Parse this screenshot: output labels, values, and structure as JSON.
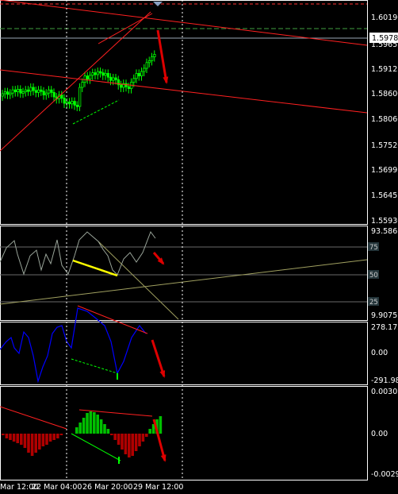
{
  "colors": {
    "background": "#000000",
    "panel_border": "#ffffff",
    "candle_up": "#00ff00",
    "candle_down": "#00ff00",
    "trendline": "#ff2020",
    "stochastic_line": "#9aa59a",
    "macd_line": "#0000ff",
    "hist_up": "#00c000",
    "hist_down": "#b00000",
    "divergence_bull": "#ffff00",
    "arrow": "#dd0000"
  },
  "price_panel": {
    "current_price": "1.59783",
    "axis_labels": [
      "1.60190",
      "1.59653",
      "1.59125",
      "1.58600",
      "1.58060",
      "1.57520",
      "1.56995",
      "1.56455",
      "1.55930"
    ]
  },
  "stochastic_panel": {
    "max_label": "93.586",
    "min_label": "9.9075",
    "levels": [
      "75",
      "50",
      "25"
    ]
  },
  "macd_panel": {
    "max_label": "278.1721",
    "zero_label": "0.00",
    "min_label": "-291.981"
  },
  "oscillator_panel": {
    "max_label": "0.003024",
    "zero_label": "0.00",
    "min_label": "-0.00290"
  },
  "time_axis": {
    "labels": [
      "Mar 12:00",
      "22 Mar 04:00",
      "26 Mar 20:00",
      "29 Mar 12:00"
    ]
  }
}
